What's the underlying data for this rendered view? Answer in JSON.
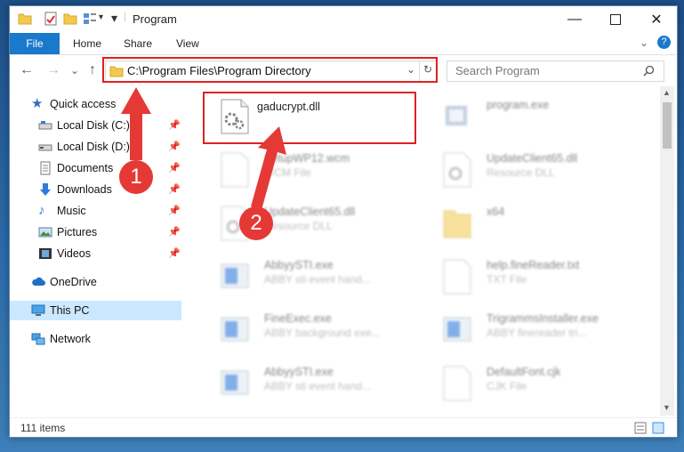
{
  "window": {
    "title": "Program"
  },
  "ribbon": {
    "file": "File",
    "tabs": [
      "Home",
      "Share",
      "View"
    ]
  },
  "address": {
    "path": "C:\\Program Files\\Program Directory"
  },
  "search": {
    "placeholder": "Search Program"
  },
  "nav": {
    "items": [
      {
        "label": "Quick access",
        "icon": "star-icon",
        "pinned": false
      },
      {
        "label": "Local Disk (C:)",
        "icon": "drive-icon",
        "pinned": true
      },
      {
        "label": "Local Disk (D:)",
        "icon": "drive-icon",
        "pinned": true
      },
      {
        "label": "Documents",
        "icon": "documents-icon",
        "pinned": true
      },
      {
        "label": "Downloads",
        "icon": "download-icon",
        "pinned": true
      },
      {
        "label": "Music",
        "icon": "music-icon",
        "pinned": true
      },
      {
        "label": "Pictures",
        "icon": "pictures-icon",
        "pinned": true
      },
      {
        "label": "Videos",
        "icon": "videos-icon",
        "pinned": true
      },
      {
        "label": "OneDrive",
        "icon": "cloud-icon",
        "pinned": false
      },
      {
        "label": "This PC",
        "icon": "pc-icon",
        "pinned": false,
        "selected": true
      },
      {
        "label": "Network",
        "icon": "network-icon",
        "pinned": false
      }
    ]
  },
  "files": [
    {
      "name": "gaducrypt.dll",
      "type": "",
      "icon": "dll-icon",
      "highlighted": true
    },
    {
      "name": "program.exe",
      "type": "",
      "icon": "exe-icon"
    },
    {
      "name": "SetupWP12.wcm",
      "type": "WCM File",
      "icon": "file-icon"
    },
    {
      "name": "UpdateClient65.dll",
      "type": "Resource DLL",
      "icon": "dll-icon"
    },
    {
      "name": "UpdateClient65.dll",
      "type": "Resource DLL",
      "icon": "dll-icon"
    },
    {
      "name": "x64",
      "type": "",
      "icon": "folder-icon"
    },
    {
      "name": "AbbyySTI.exe",
      "type": "ABBY sti event hand...",
      "icon": "app-icon"
    },
    {
      "name": "help.fineReader.txt",
      "type": "TXT File",
      "icon": "file-icon"
    },
    {
      "name": "FineExec.exe",
      "type": "ABBY background exe...",
      "icon": "app-icon"
    },
    {
      "name": "TrigrammsInstaller.exe",
      "type": "ABBY finereader tri...",
      "icon": "app-icon"
    },
    {
      "name": "AbbyySTI.exe",
      "type": "ABBY sti event hand...",
      "icon": "app-icon"
    },
    {
      "name": "DefaultFont.cjk",
      "type": "CJK File",
      "icon": "file-icon"
    }
  ],
  "status": {
    "items": "111 items"
  },
  "annotations": {
    "step1": "1",
    "step2": "2",
    "color": "#e53935"
  }
}
